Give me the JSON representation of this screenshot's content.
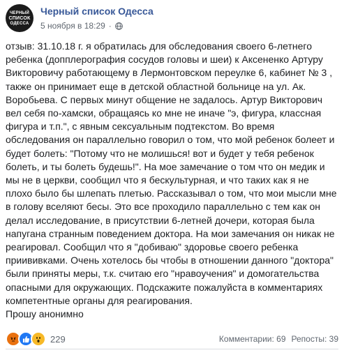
{
  "avatar": {
    "line1": "ЧЕРНЫЙ",
    "line2": "СПИСОК",
    "line3": "ОДЕССА"
  },
  "header": {
    "page_name": "Черный список Одесса",
    "timestamp": "5 ноября в 18:29",
    "separator": "·",
    "privacy_icon": "globe-icon"
  },
  "post": {
    "text": "отзыв: 31.10.18 г. я обратилась для обследования своего 6-летнего\nребенка (допплерография сосудов головы и шеи) к Аксененко Артуру\nВикторовичу работающему в Лермонтовском переулке 6, кабинет № 3 ,\nтакже он принимает еще в детской областной больнице на ул. Ак.\nВоробьева. С первых минут общение не задалось. Артур Викторович\nвел себя по-хамски, обращаясь ко мне не иначе \"э, фигура, классная\nфигура и т.п.\", с явным сексуальным подтекстом. Во время\nобследования он параллельно говорил о том, что мой ребенок болеет и\nбудет болеть: \"Потому что не молишься! вот и будет у тебя ребенок\nболеть, и ты болеть будешь!\". На мое замечание о том что он медик и\nмы не в церкви, сообщил что я бескультурная, и что таких как я не\nплохо было бы шлепать плетью. Рассказывал о том, что мои мысли мне\nв голову вселяют бесы. Это все проходило параллельно с тем как он\nделал исследование, в присутствии 6-летней дочери, которая была\nнапугана странным поведением доктора. На мои замечания он никак не\nреагировал. Сообщил что я \"добиваю\" здоровье своего ребенка\nприививками. Очень хотелось бы чтобы в отношении данного \"доктора\"\nбыли приняты меры, т.к. считаю его \"нравоучения\" и домогательства\nопасными для окружающих. Подскажите пожалуйста в комментариях\nкомпетентные органы для реагирования.\nПрошу анонимно"
  },
  "footer": {
    "reactions": [
      "angry",
      "like",
      "wow"
    ],
    "reaction_count": "229",
    "comments": "Комментарии: 69",
    "shares": "Репосты: 39"
  },
  "colors": {
    "link": "#385898",
    "meta": "#606770",
    "like": "#2078f4",
    "angry": "#e9710f",
    "wow": "#f7b928"
  }
}
